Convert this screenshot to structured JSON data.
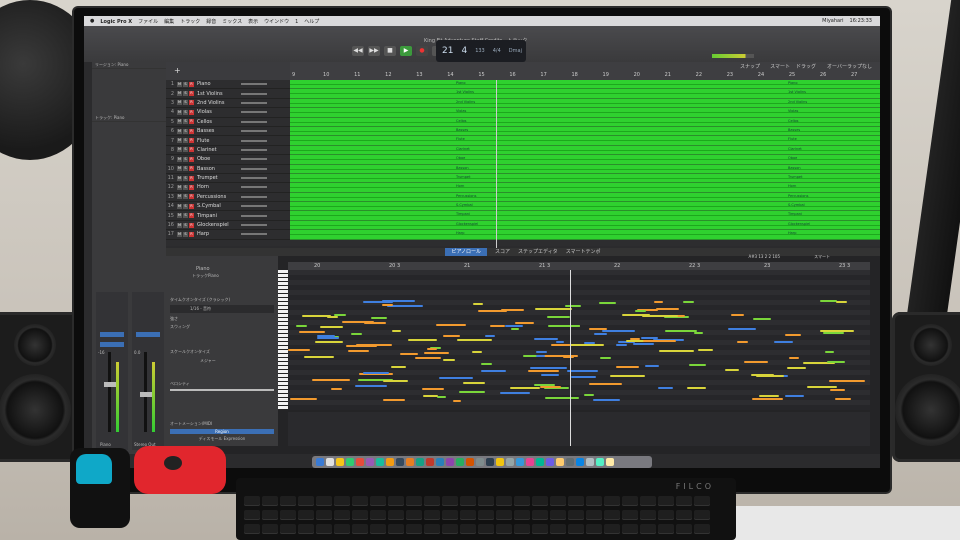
{
  "scene": "photo of a computer monitor showing a music production app with a piano-roll editor",
  "app": {
    "name": "Logic Pro X",
    "window_title": "King Fit Adventure Staff Credits - トラック",
    "clock": "16:23:33",
    "user": "Miyahari"
  },
  "menubar": {
    "items": [
      "Logic Pro X",
      "ファイル",
      "編集",
      "トラック",
      "録音",
      "ミックス",
      "表示",
      "ウインドウ",
      "1",
      "ヘルプ"
    ]
  },
  "transport": {
    "position_bar": "21",
    "position_beat": "4",
    "tempo": "133",
    "signature": "4/4",
    "key": "Dmaj"
  },
  "track_area": {
    "snap_label": "スナップ",
    "snap_value": "スマート",
    "drag_label": "ドラッグ",
    "drag_value": "オーバーラップなし",
    "ruler_marks": [
      "9",
      "10",
      "11",
      "12",
      "13",
      "14",
      "15",
      "16",
      "17",
      "18",
      "19",
      "20",
      "21",
      "22",
      "23",
      "24",
      "25",
      "26",
      "27"
    ],
    "tracks": [
      {
        "num": "1",
        "name": "Piano"
      },
      {
        "num": "2",
        "name": "1st Violins"
      },
      {
        "num": "3",
        "name": "2nd Violins"
      },
      {
        "num": "4",
        "name": "Violas"
      },
      {
        "num": "5",
        "name": "Cellos"
      },
      {
        "num": "6",
        "name": "Basses"
      },
      {
        "num": "7",
        "name": "Flute"
      },
      {
        "num": "8",
        "name": "Clarinet"
      },
      {
        "num": "9",
        "name": "Oboe"
      },
      {
        "num": "10",
        "name": "Basson"
      },
      {
        "num": "11",
        "name": "Trumpet"
      },
      {
        "num": "12",
        "name": "Horn"
      },
      {
        "num": "13",
        "name": "Percussions"
      },
      {
        "num": "14",
        "name": "S.Cymbal"
      },
      {
        "num": "15",
        "name": "Timpani"
      },
      {
        "num": "16",
        "name": "Glockenspiel"
      },
      {
        "num": "17",
        "name": "Harp"
      }
    ]
  },
  "inspector": {
    "region_header": "リージョン: Piano",
    "track_header": "トラック: Piano",
    "strip_left_label": "Piano",
    "strip_right_label": "Stereo Out",
    "strip_left_value": "-16",
    "strip_right_value": "0.0"
  },
  "editor": {
    "tabs": [
      "ピアノロール",
      "スコア",
      "ステップエディタ",
      "スマートテンポ"
    ],
    "active_tab": "ピアノロール",
    "region_name": "Piano",
    "region_sub": "トラックPiano",
    "quantize_label": "タイムクオンタイズ (クラシック)",
    "quantize_value": "1/16 - 音符",
    "strength_label": "強さ",
    "swing_label": "スウィング",
    "scale_label": "スケールクオンタイズ",
    "scale_value": "メジャー",
    "velocity_label": "ベロシティ",
    "automation_label": "オートメーション/MIDI",
    "automation_mode": "Region",
    "automation_param": "ディスモール Expression",
    "snap_value": "スマート",
    "position_readout": "A#3  13 2 2 105",
    "ruler_marks": [
      "20",
      "20 3",
      "21",
      "21 3",
      "22",
      "22 3",
      "23",
      "23 3"
    ]
  },
  "colors": {
    "region_green": "#2fd12f",
    "accent_blue": "#3b6fb5",
    "note_orange": "#f29a2e",
    "note_green": "#7ad63a",
    "note_yellow": "#d8d43a",
    "note_blue": "#3f7fe0"
  },
  "keyboard_brand": "FILCO"
}
